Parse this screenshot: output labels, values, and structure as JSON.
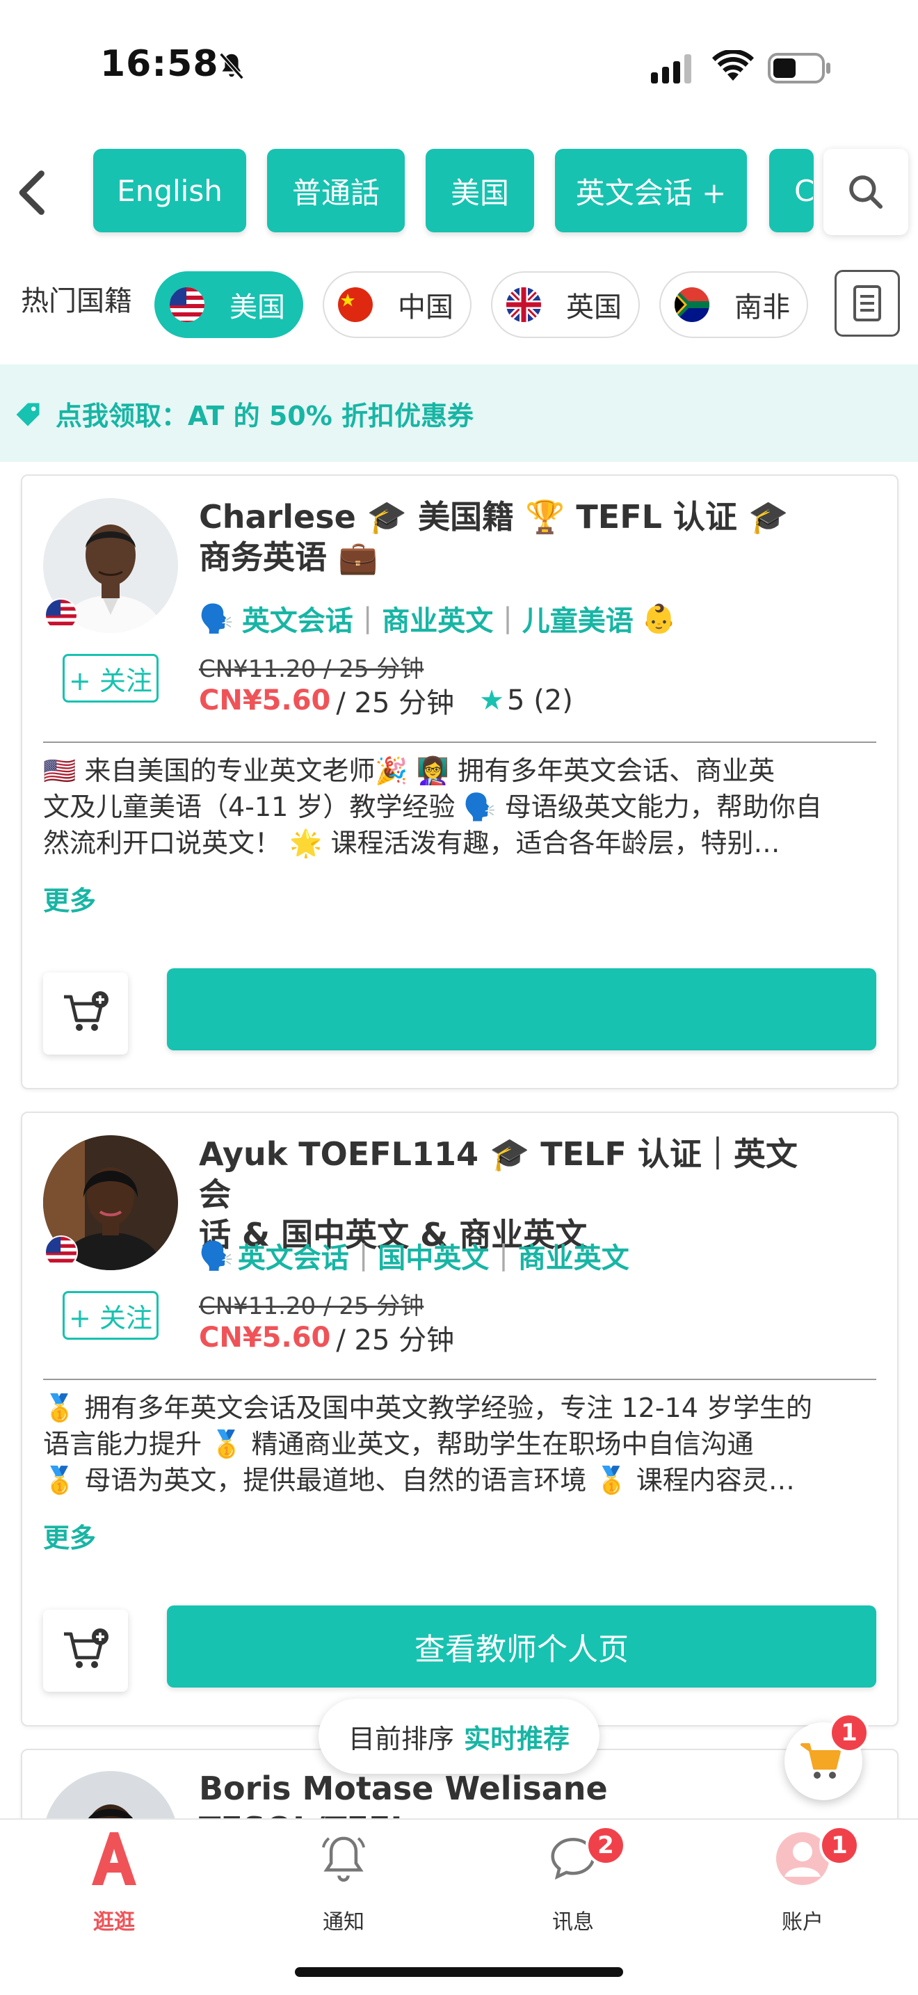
{
  "status_bar": {
    "time": "16:58"
  },
  "tags": [
    "English",
    "普通話",
    "美国",
    "英文会话 +",
    "C"
  ],
  "nationality": {
    "label": "热门国籍",
    "options": [
      {
        "name": "美国",
        "flag": "us",
        "active": true
      },
      {
        "name": "中国",
        "flag": "cn",
        "active": false
      },
      {
        "name": "英国",
        "flag": "uk",
        "active": false
      },
      {
        "name": "南非",
        "flag": "za",
        "active": false
      }
    ]
  },
  "coupon": {
    "text": "点我领取：AT 的 50% 折扣优惠券"
  },
  "teachers": [
    {
      "name_line1": "Charlese 🎓 美国籍 🏆 TEFL 认证 🎓",
      "name_line2": "商务英语 💼",
      "topics_prefix": "🗣️",
      "topics": [
        "英文会话",
        "商业英文",
        "儿童美语"
      ],
      "topics_suffix": "👶",
      "follow": "+ 关注",
      "old_price": "CN¥11.20 / 25 分钟",
      "price": "CN¥5.60",
      "per": "/ 25 分钟",
      "rating_star": "★",
      "rating": "5 (2)",
      "desc_lines": [
        "🇺🇸 来自美国的专业英文老师🎉 👩‍🏫 拥有多年英文会话、商业英",
        "文及儿童美语（4-11 岁）教学经验 🗣️ 母语级英文能力，帮助你自",
        "然流利开口说英文！ 🌟 课程活泼有趣，适合各年龄层，特别…"
      ],
      "more": "更多",
      "profile_button": ""
    },
    {
      "name_line1": "Ayuk TOEFL114 🎓 TELF 认证｜英文会",
      "name_line2": "话 & 国中英文 & 商业英文",
      "topics_prefix": "🗣️",
      "topics": [
        "英文会话",
        "国中英文",
        "商业英文"
      ],
      "topics_suffix": "",
      "follow": "+ 关注",
      "old_price": "CN¥11.20 / 25 分钟",
      "price": "CN¥5.60",
      "per": "/ 25 分钟",
      "desc_lines": [
        "🥇 拥有多年英文会话及国中英文教学经验，专注 12-14 岁学生的",
        "语言能力提升 🥇 精通商业英文，帮助学生在职场中自信沟通",
        "🥇 母语为英文，提供最道地、自然的语言环境 🥇 课程内容灵…"
      ],
      "more": "更多",
      "profile_button": "查看教师个人页"
    },
    {
      "name_line1": "Boris Motase Welisane TESOL/TEFL"
    }
  ],
  "sort": {
    "label": "目前排序",
    "value": "实时推荐"
  },
  "cart_badge": "1",
  "nav": [
    {
      "label": "逛逛",
      "icon": "home-a-icon",
      "active": true
    },
    {
      "label": "通知",
      "icon": "bell-icon",
      "active": false
    },
    {
      "label": "讯息",
      "icon": "chat-icon",
      "active": false,
      "badge": "2"
    },
    {
      "label": "账户",
      "icon": "user-icon",
      "active": false,
      "badge": "1"
    }
  ],
  "colors": {
    "accent": "#17c2b0",
    "price": "#ef5358",
    "badge": "#f0414a"
  }
}
